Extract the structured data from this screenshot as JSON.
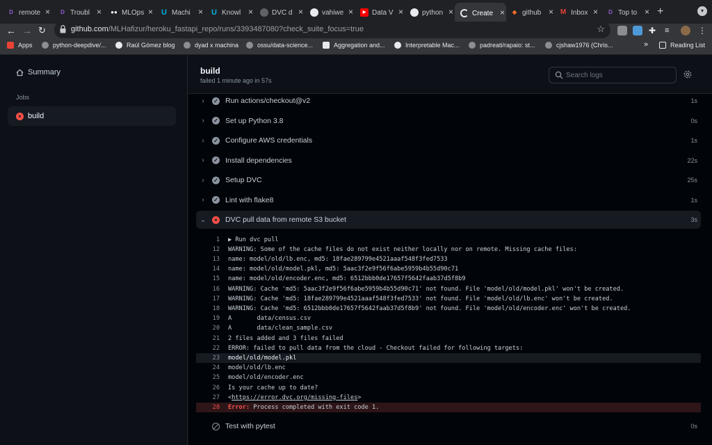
{
  "browser": {
    "tabs": [
      {
        "label": "remote",
        "icon": "dvc-icon"
      },
      {
        "label": "Troubl",
        "icon": "dvc-icon"
      },
      {
        "label": "MLOps",
        "icon": "medium-icon"
      },
      {
        "label": "Machi",
        "icon": "udacity-icon"
      },
      {
        "label": "Knowl",
        "icon": "udacity-icon"
      },
      {
        "label": "DVC d",
        "icon": "globe-icon"
      },
      {
        "label": "vahiwe",
        "icon": "github-icon"
      },
      {
        "label": "Data V",
        "icon": "youtube-icon"
      },
      {
        "label": "python",
        "icon": "github-icon"
      },
      {
        "label": "Create",
        "icon": "loading-icon"
      },
      {
        "label": "github",
        "icon": "gitlab-icon"
      },
      {
        "label": "Inbox",
        "icon": "gmail-icon"
      },
      {
        "label": "Top to",
        "icon": "dvc-icon"
      }
    ],
    "url_host": "github.com",
    "url_path": "/MLHafizur/heroku_fastapi_repo/runs/3393487080?check_suite_focus=true",
    "bookmarks": [
      "Apps",
      "python-deepdive/...",
      "Raúl Gómez blog",
      "dyad x machina",
      "ossu/data-science...",
      "Aggregation and...",
      "Interpretable Mac...",
      "padreati/rapaio: st...",
      "cjshaw1976 (Chris..."
    ],
    "overflow": "»",
    "reading_list": "Reading List"
  },
  "sidebar": {
    "summary": "Summary",
    "jobs_heading": "Jobs",
    "job": "build"
  },
  "job": {
    "title": "build",
    "subtitle": "failed 1 minute ago in 57s",
    "search_placeholder": "Search logs"
  },
  "steps": [
    {
      "name": "Run actions/checkout@v2",
      "duration": "1s",
      "status": "success"
    },
    {
      "name": "Set up Python 3.8",
      "duration": "0s",
      "status": "success"
    },
    {
      "name": "Configure AWS credentials",
      "duration": "1s",
      "status": "success"
    },
    {
      "name": "Install dependencies",
      "duration": "22s",
      "status": "success"
    },
    {
      "name": "Setup DVC",
      "duration": "25s",
      "status": "success"
    },
    {
      "name": "Lint with flake8",
      "duration": "1s",
      "status": "success"
    },
    {
      "name": "DVC pull data from remote S3 bucket",
      "duration": "3s",
      "status": "failure"
    }
  ],
  "log": [
    {
      "n": "1",
      "t": "▶ Run dvc pull"
    },
    {
      "n": "12",
      "t": "WARNING: Some of the cache files do not exist neither locally nor on remote. Missing cache files:"
    },
    {
      "n": "13",
      "t": "name: model/old/lb.enc, md5: 18fae289799e4521aaaf548f3fed7533"
    },
    {
      "n": "14",
      "t": "name: model/old/model.pkl, md5: 5aac3f2e9f56f6abe5959b4b55d90c71"
    },
    {
      "n": "15",
      "t": "name: model/old/encoder.enc, md5: 6512bbb0de17657f5642faab37d5f8b9"
    },
    {
      "n": "16",
      "t": "WARNING: Cache 'md5: 5aac3f2e9f56f6abe5959b4b55d90c71' not found. File 'model/old/model.pkl' won't be created."
    },
    {
      "n": "17",
      "t": "WARNING: Cache 'md5: 18fae289799e4521aaaf548f3fed7533' not found. File 'model/old/lb.enc' won't be created."
    },
    {
      "n": "18",
      "t": "WARNING: Cache 'md5: 6512bbb0de17657f5642faab37d5f8b9' not found. File 'model/old/encoder.enc' won't be created."
    },
    {
      "n": "19",
      "t": "A       data/census.csv"
    },
    {
      "n": "20",
      "t": "A       data/clean_sample.csv"
    },
    {
      "n": "21",
      "t": "2 files added and 3 files failed"
    },
    {
      "n": "22",
      "t": "ERROR: failed to pull data from the cloud - Checkout failed for following targets:"
    },
    {
      "n": "23",
      "t": "model/old/model.pkl"
    },
    {
      "n": "24",
      "t": "model/old/lb.enc"
    },
    {
      "n": "25",
      "t": "model/old/encoder.enc"
    },
    {
      "n": "26",
      "t": "Is your cache up to date?"
    },
    {
      "n": "27",
      "t_pre": "<",
      "link": "https://error.dvc.org/missing-files",
      "t_post": ">"
    },
    {
      "n": "28",
      "err_word": "Error:",
      "t": " Process completed with exit code 1."
    }
  ],
  "after_steps": [
    {
      "name": "Test with pytest",
      "duration": "0s",
      "status": "skipped"
    }
  ],
  "colors": {
    "background": "#0d1117",
    "failure": "#f85149",
    "muted": "#8b949e"
  }
}
